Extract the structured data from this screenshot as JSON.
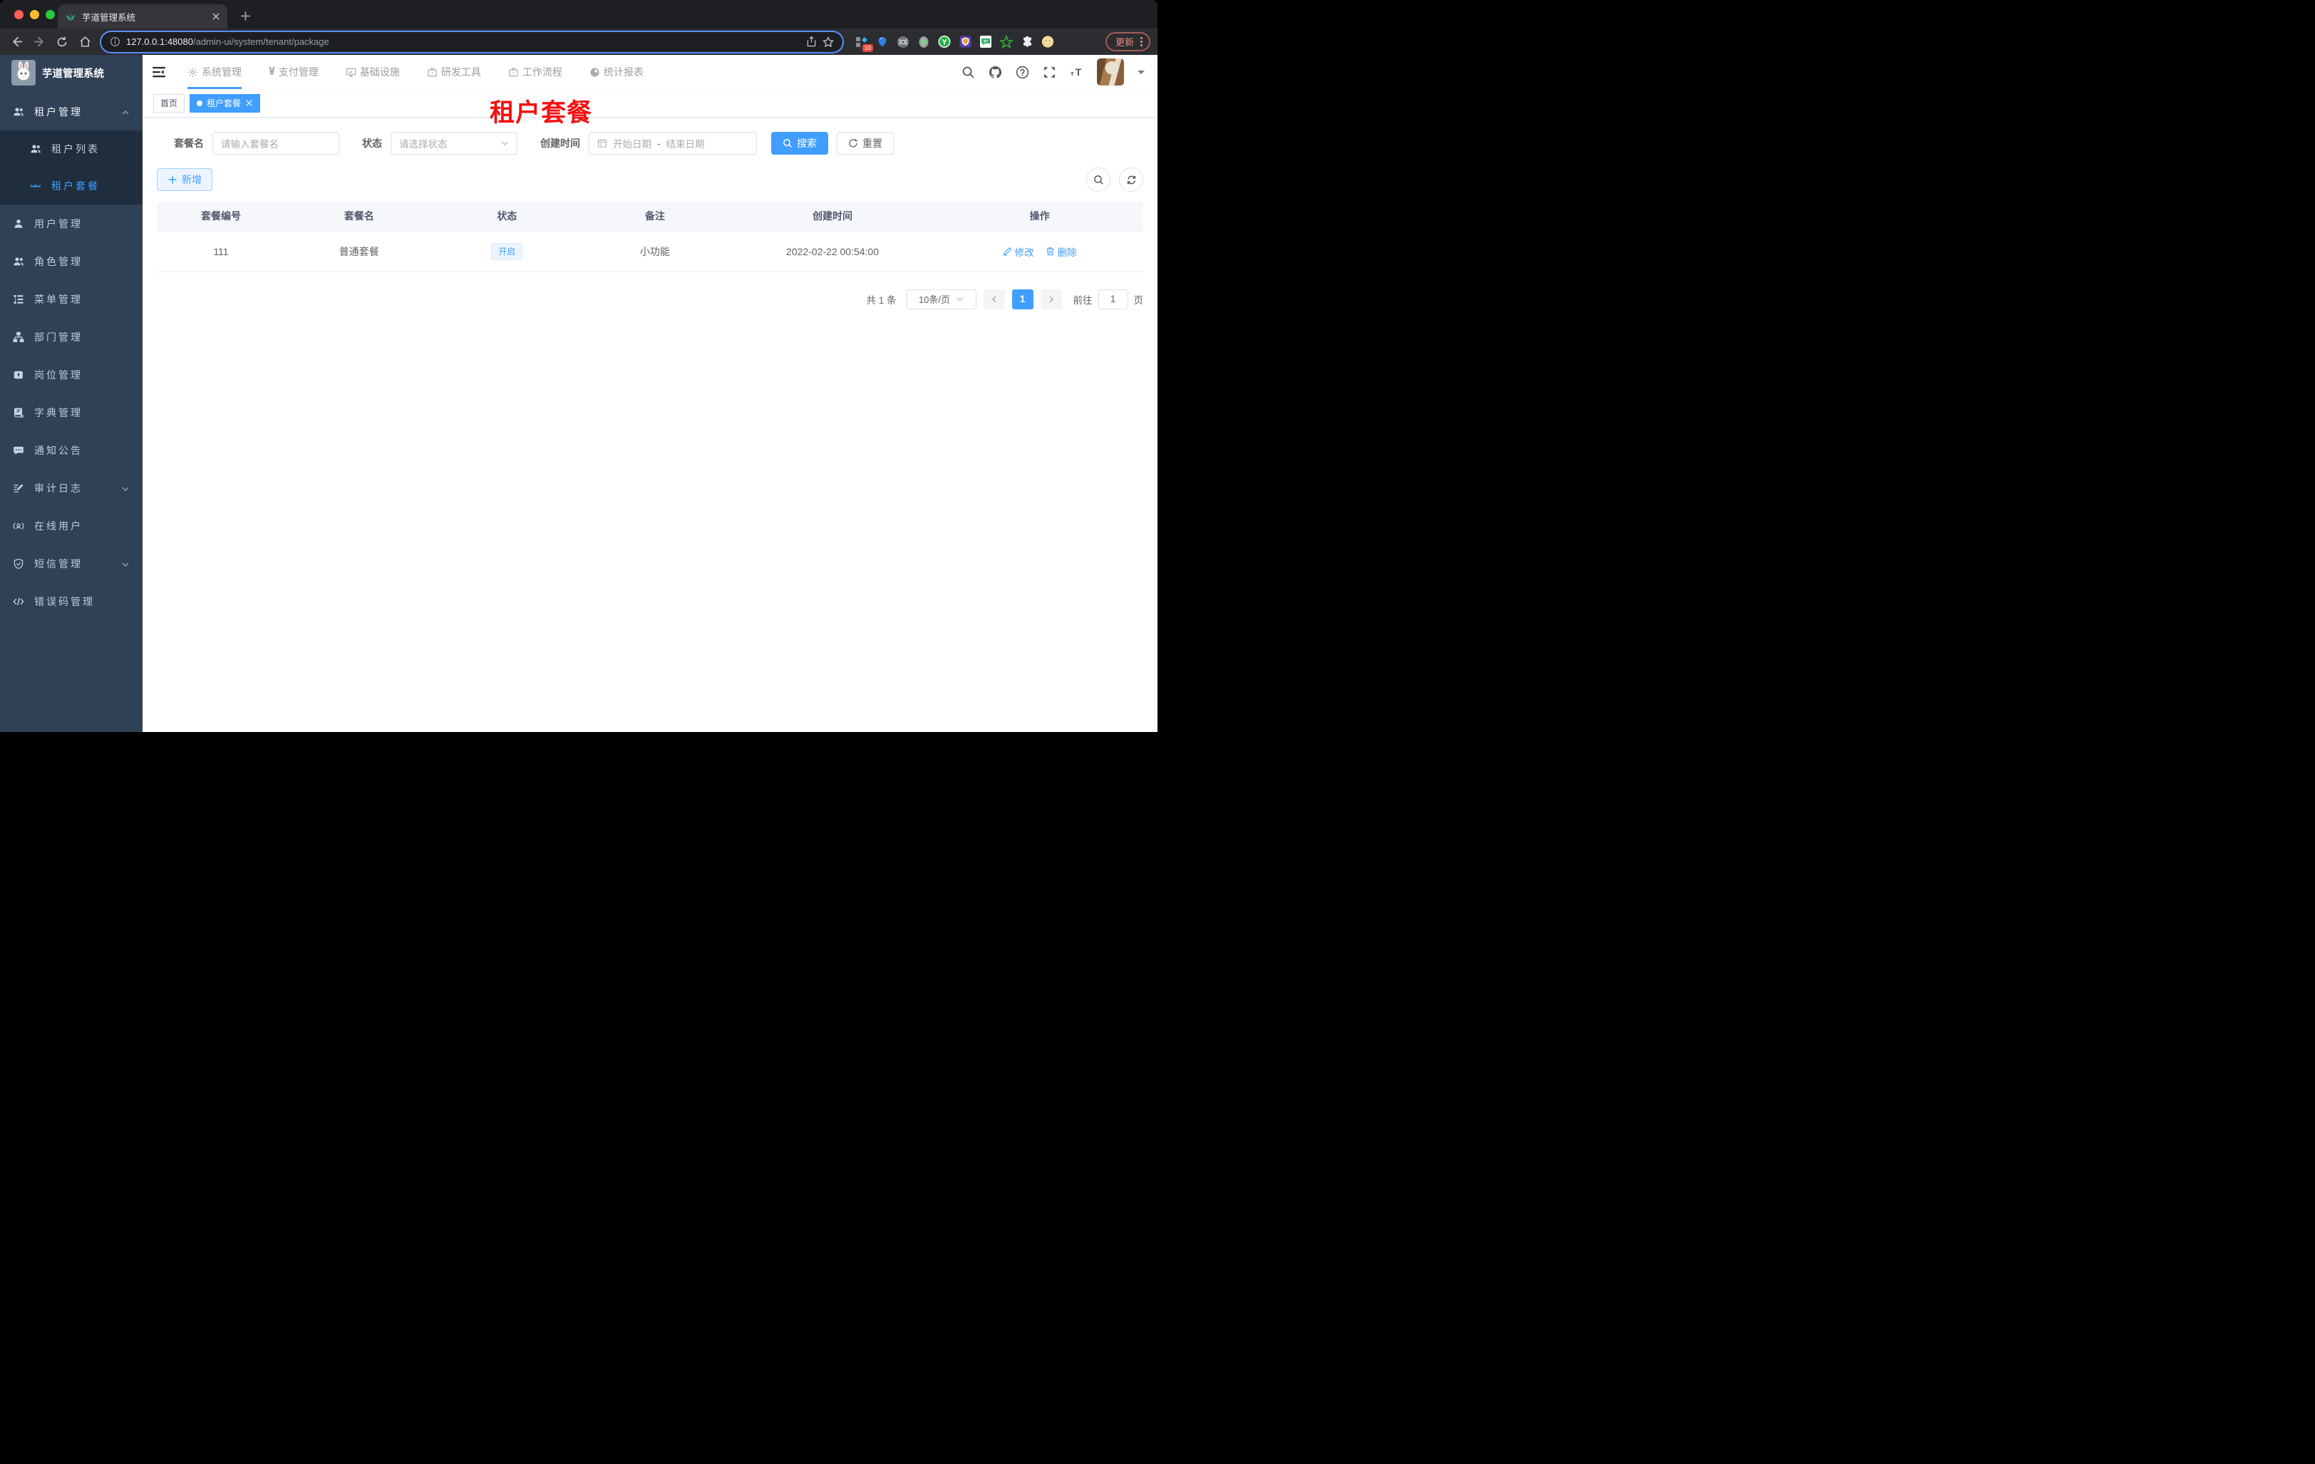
{
  "browser": {
    "tab_title": "芋道管理系统",
    "url_host": "127.0.0.1:48080",
    "url_path": "/admin-ui/system/tenant/package",
    "update_label": "更新",
    "ext_badge": "10"
  },
  "colors": {
    "accent": "#409eff",
    "watermark": "#f50f0f",
    "sidebar_bg": "#304156",
    "submenu_bg": "#1f2d3d"
  },
  "app": {
    "logo_title": "芋道管理系统",
    "nav": {
      "items": [
        {
          "label": "系统管理"
        },
        {
          "label": "支付管理",
          "icon_char": "¥"
        },
        {
          "label": "基础设施"
        },
        {
          "label": "研发工具"
        },
        {
          "label": "工作流程"
        },
        {
          "label": "统计报表"
        }
      ]
    },
    "sidebar": {
      "items": [
        {
          "label": "租户管理"
        },
        {
          "label": "租户列表"
        },
        {
          "label": "租户套餐"
        },
        {
          "label": "用户管理"
        },
        {
          "label": "角色管理"
        },
        {
          "label": "菜单管理"
        },
        {
          "label": "部门管理"
        },
        {
          "label": "岗位管理"
        },
        {
          "label": "字典管理"
        },
        {
          "label": "通知公告"
        },
        {
          "label": "审计日志"
        },
        {
          "label": "在线用户"
        },
        {
          "label": "短信管理"
        },
        {
          "label": "错误码管理"
        }
      ]
    },
    "tags": {
      "home": "首页",
      "active": "租户套餐"
    },
    "watermark": "租户套餐",
    "filter": {
      "name_label": "套餐名",
      "name_placeholder": "请输入套餐名",
      "status_label": "状态",
      "status_placeholder": "请选择状态",
      "date_label": "创建时间",
      "date_start_placeholder": "开始日期",
      "date_separator": "-",
      "date_end_placeholder": "结束日期",
      "search_label": "搜索",
      "reset_label": "重置"
    },
    "toolbar": {
      "add_label": "新增"
    },
    "table": {
      "headers": [
        "套餐编号",
        "套餐名",
        "状态",
        "备注",
        "创建时间",
        "操作"
      ],
      "rows": [
        {
          "id": "111",
          "name": "普通套餐",
          "status": "开启",
          "remark": "小功能",
          "created_at": "2022-02-22 00:54:00",
          "edit_label": "修改",
          "delete_label": "删除"
        }
      ]
    },
    "pagination": {
      "total_text": "共 1 条",
      "page_size": "10条/页",
      "current_page": "1",
      "goto_label": "前往",
      "goto_value": "1",
      "page_unit": "页"
    }
  }
}
